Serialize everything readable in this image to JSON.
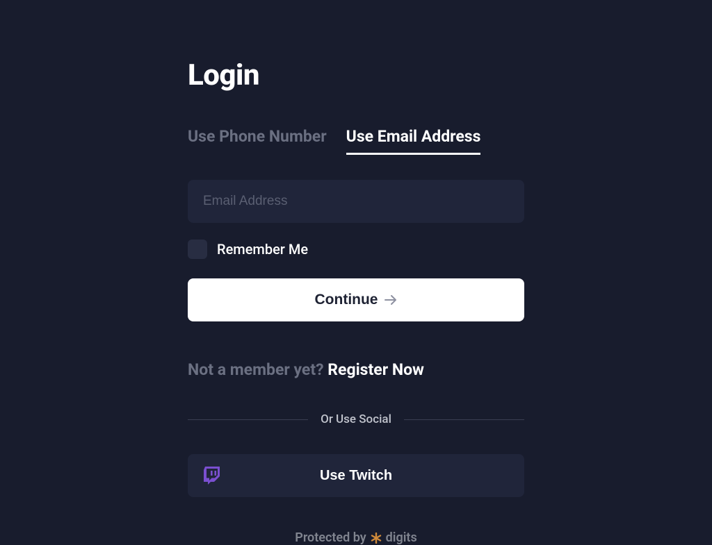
{
  "title": "Login",
  "tabs": {
    "phone": "Use Phone Number",
    "email": "Use Email Address"
  },
  "form": {
    "email_placeholder": "Email Address",
    "remember_label": "Remember Me",
    "continue_label": "Continue"
  },
  "register": {
    "prompt": "Not a member yet? ",
    "link": "Register Now"
  },
  "divider": "Or Use Social",
  "social": {
    "twitch_label": "Use Twitch"
  },
  "footer": {
    "protected": "Protected by",
    "brand": "digits"
  }
}
